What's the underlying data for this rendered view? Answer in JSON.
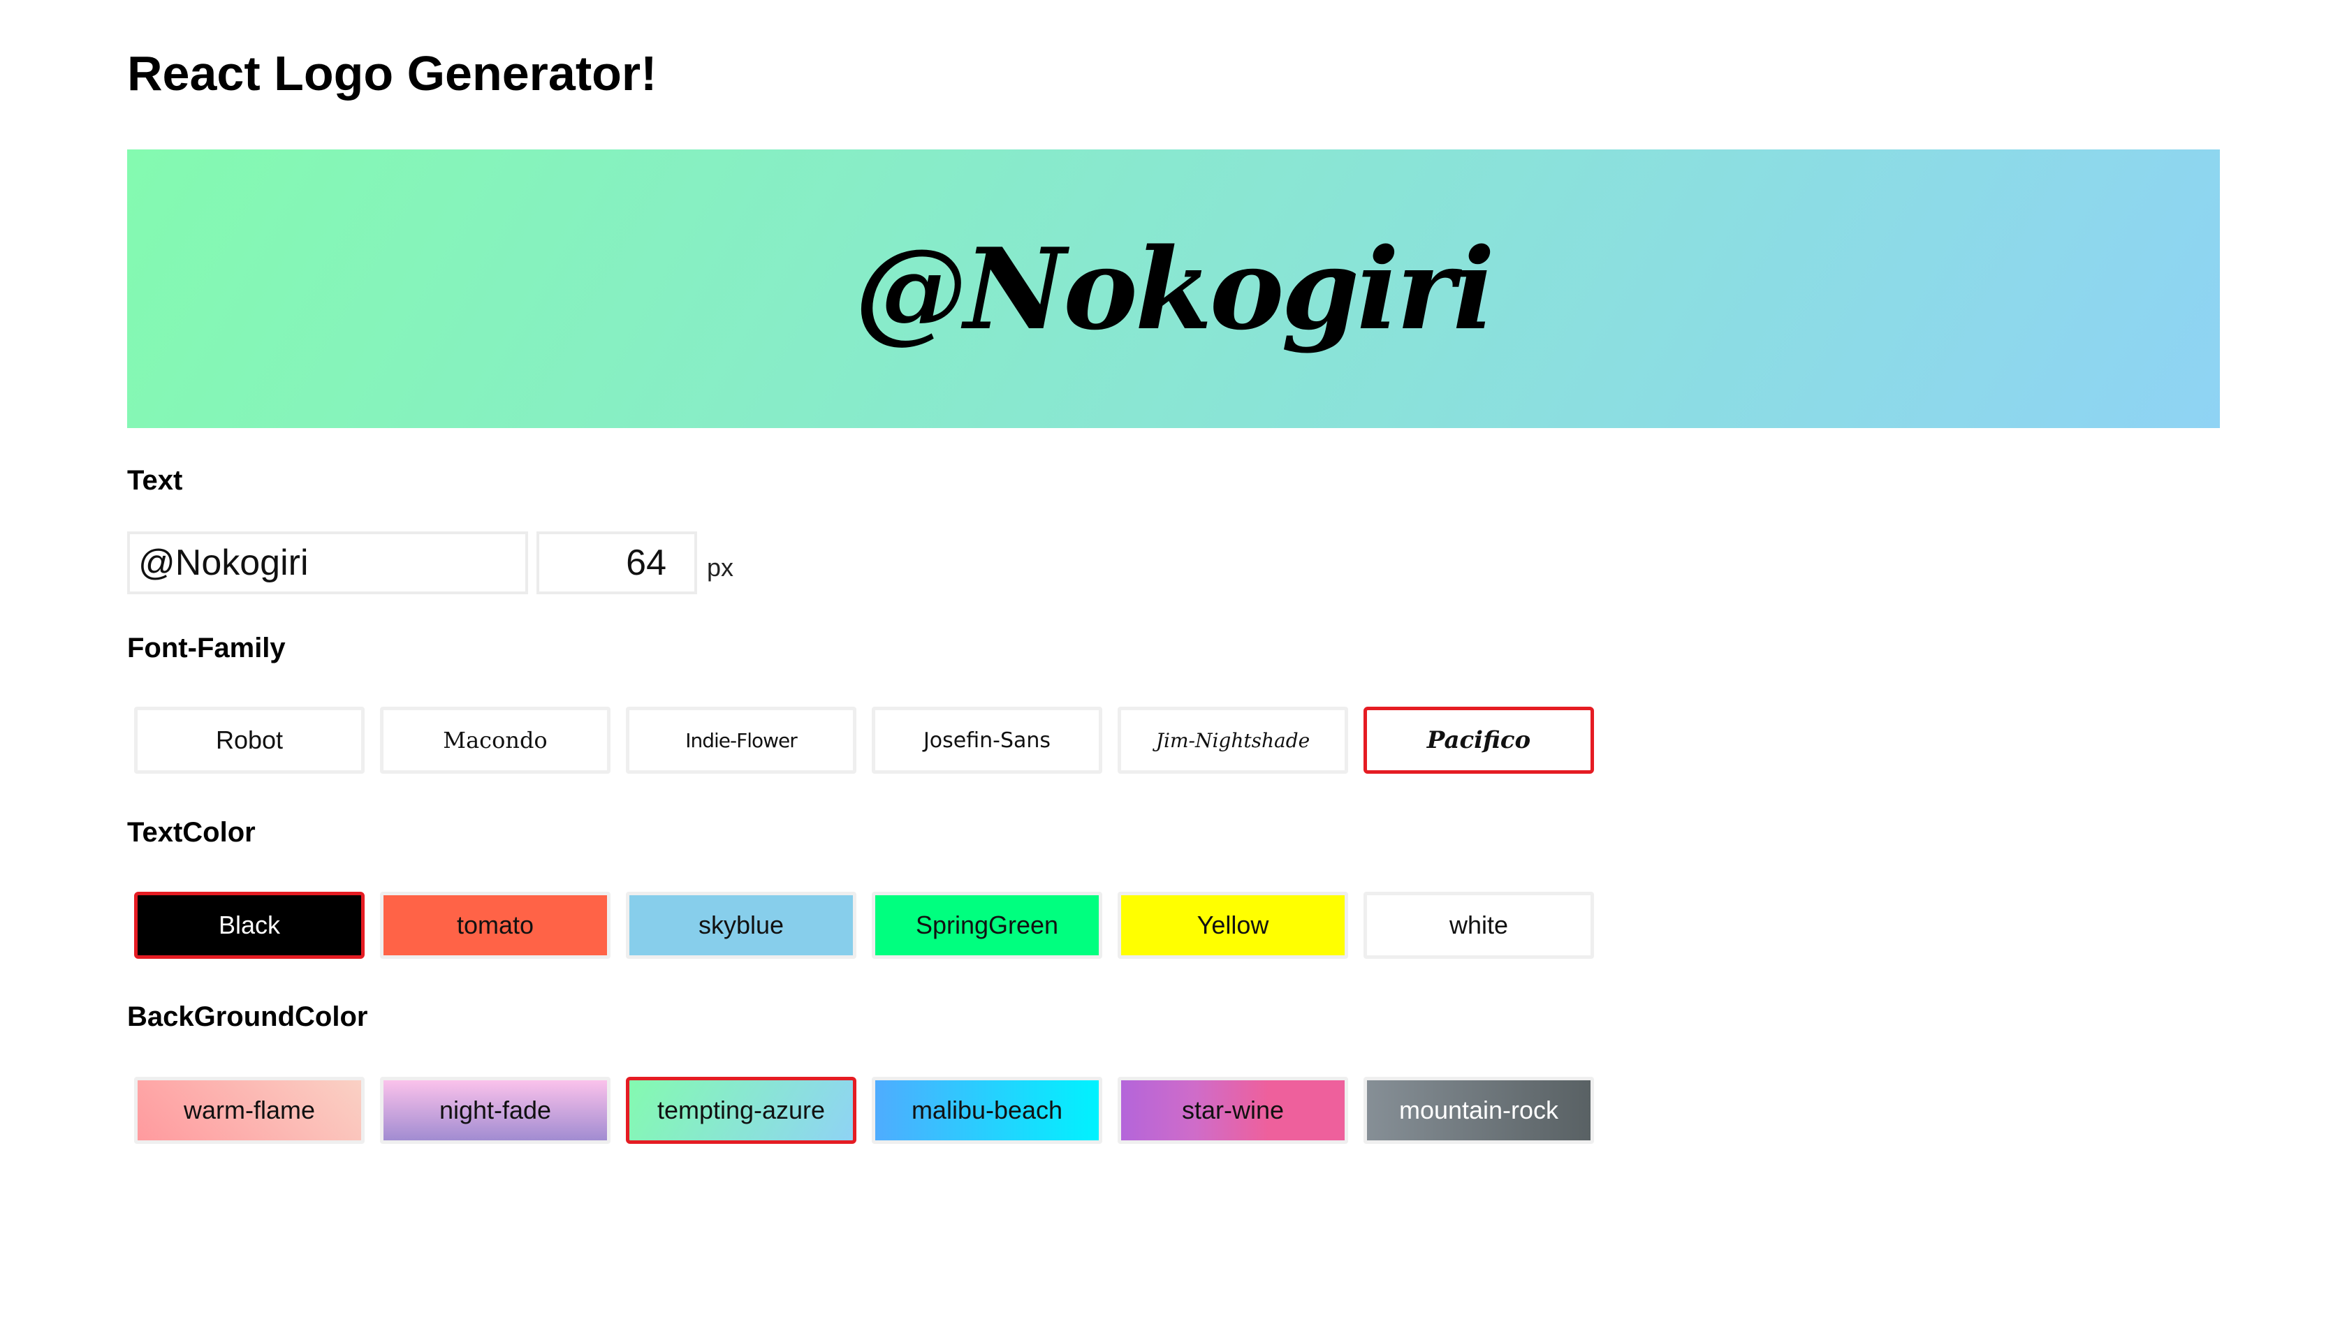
{
  "title": "React Logo Generator!",
  "preview": {
    "text": "@Nokogiri"
  },
  "text_section": {
    "label": "Text",
    "text_value": "@Nokogiri",
    "size_value": "64",
    "unit": "px"
  },
  "font_section": {
    "label": "Font-Family",
    "options": [
      {
        "label": "Robot",
        "selected": false
      },
      {
        "label": "Macondo",
        "selected": false
      },
      {
        "label": "Indie-Flower",
        "selected": false
      },
      {
        "label": "Josefin-Sans",
        "selected": false
      },
      {
        "label": "Jim-Nightshade",
        "selected": false
      },
      {
        "label": "Pacifico",
        "selected": true
      }
    ]
  },
  "textcolor_section": {
    "label": "TextColor",
    "options": [
      {
        "label": "Black",
        "bg": "#000000",
        "fg": "#ffffff",
        "selected": true
      },
      {
        "label": "tomato",
        "bg": "#ff6347",
        "fg": "#111111",
        "selected": false
      },
      {
        "label": "skyblue",
        "bg": "#87ceeb",
        "fg": "#111111",
        "selected": false
      },
      {
        "label": "SpringGreen",
        "bg": "#00ff7f",
        "fg": "#111111",
        "selected": false
      },
      {
        "label": "Yellow",
        "bg": "#ffff00",
        "fg": "#111111",
        "selected": false
      },
      {
        "label": "white",
        "bg": "#ffffff",
        "fg": "#111111",
        "selected": false
      }
    ]
  },
  "bgcolor_section": {
    "label": "BackGroundColor",
    "options": [
      {
        "label": "warm-flame",
        "gradient": "linear-gradient(45deg, #ff9a9e 0%, #fad0c4 99%, #fad0c4 100%)",
        "fg": "#111111",
        "selected": false
      },
      {
        "label": "night-fade",
        "gradient": "linear-gradient(to top, #a18cd1 0%, #fbc2eb 100%)",
        "fg": "#111111",
        "selected": false
      },
      {
        "label": "tempting-azure",
        "gradient": "linear-gradient(120deg, #84fab0 0%, #8fd3f4 100%)",
        "fg": "#111111",
        "selected": true
      },
      {
        "label": "malibu-beach",
        "gradient": "linear-gradient(to right, #4facfe 0%, #00f2fe 100%)",
        "fg": "#111111",
        "selected": false
      },
      {
        "label": "star-wine",
        "gradient": "linear-gradient(to right, #b465da 0%, #cf6cc9 33%, #ee609c 66%, #ee609c 100%)",
        "fg": "#111111",
        "selected": false
      },
      {
        "label": "mountain-rock",
        "gradient": "linear-gradient(to right, #868f96 0%, #596164 100%)",
        "fg": "#ffffff",
        "selected": false
      }
    ]
  }
}
